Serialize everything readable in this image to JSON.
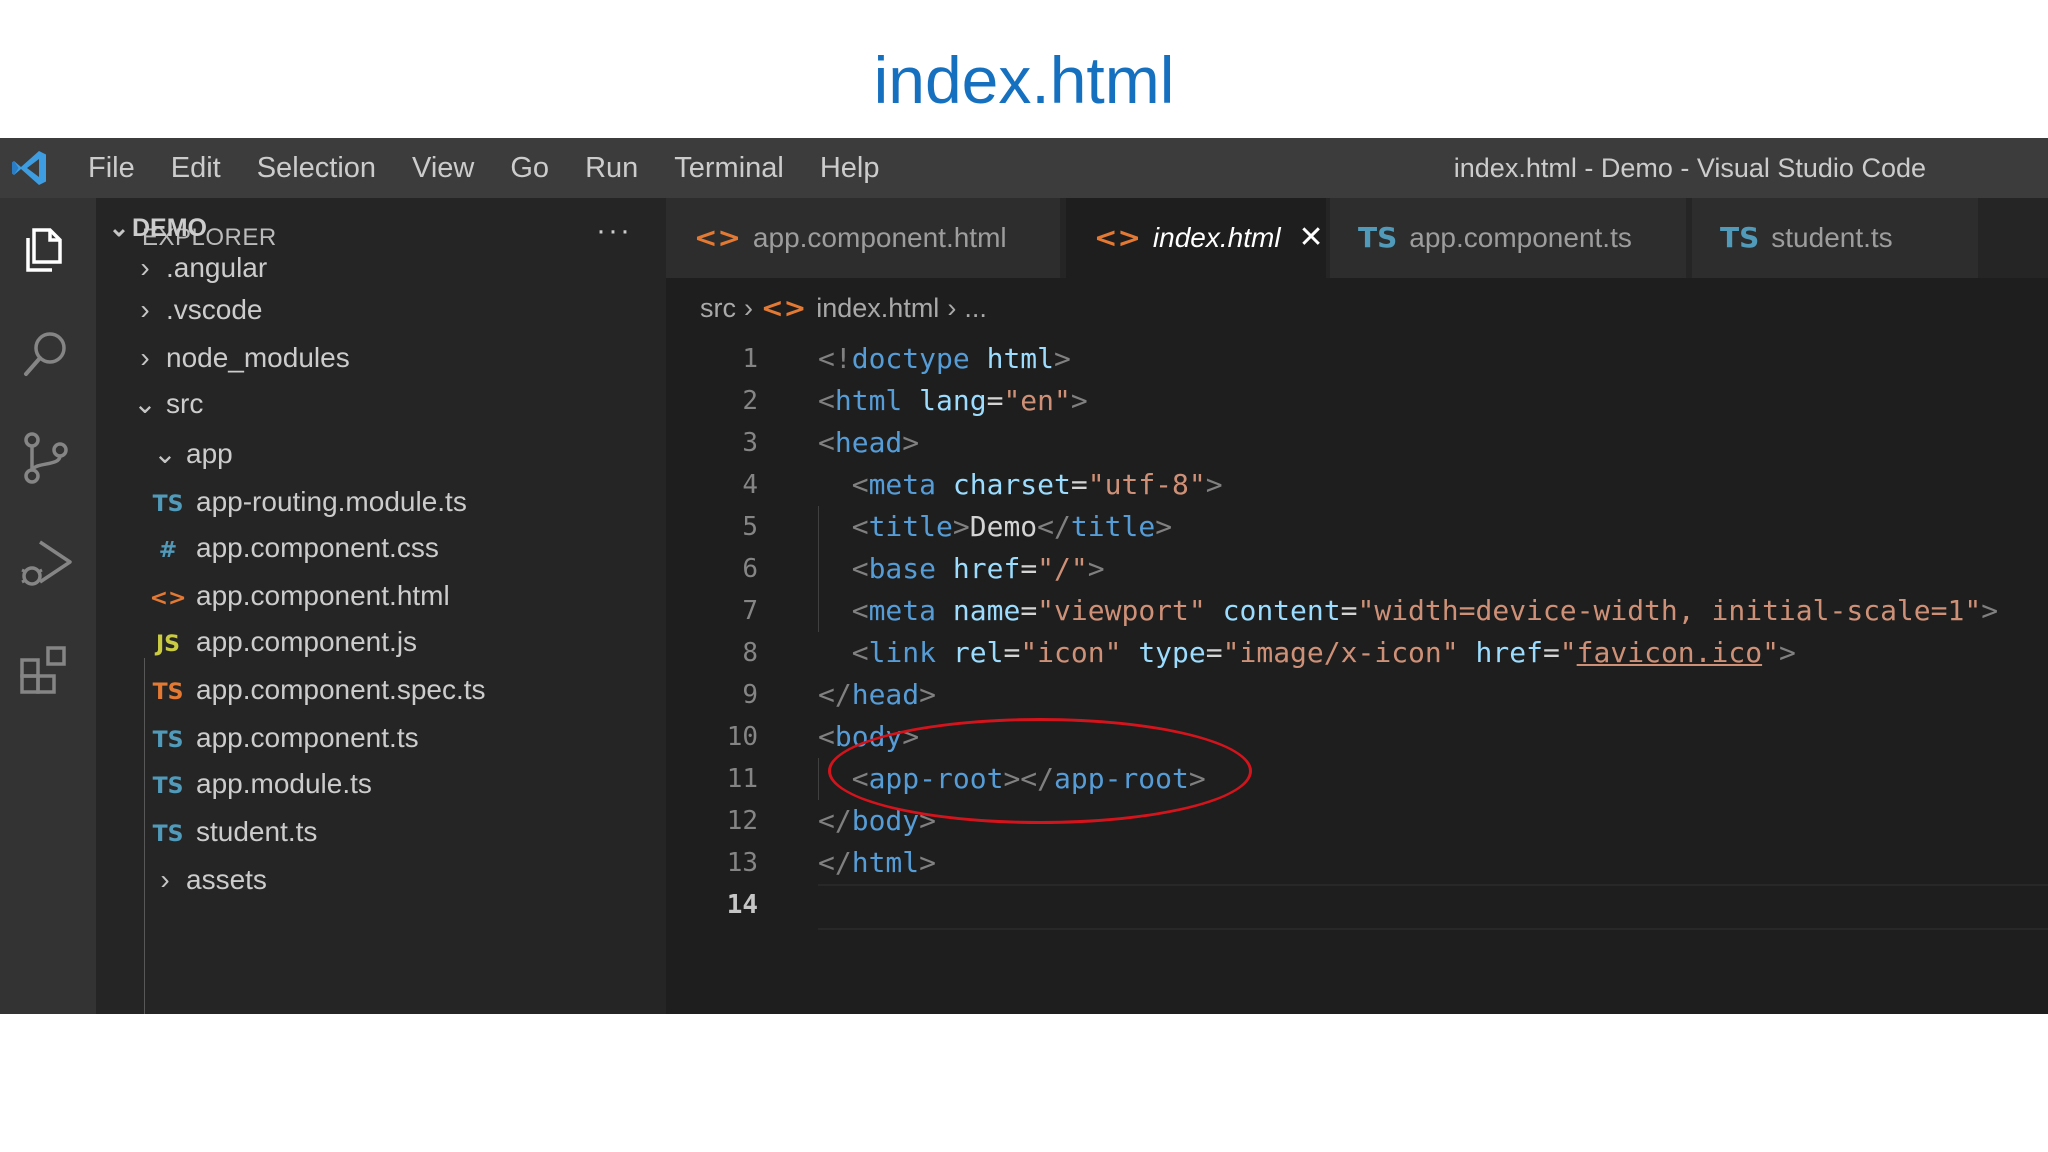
{
  "slide": {
    "title": "index.html"
  },
  "titlebar": {
    "menu": [
      "File",
      "Edit",
      "Selection",
      "View",
      "Go",
      "Run",
      "Terminal",
      "Help"
    ],
    "window_title": "index.html - Demo - Visual Studio Code"
  },
  "activity_bar": {
    "icons": [
      "explorer-icon",
      "search-icon",
      "source-control-icon",
      "run-debug-icon",
      "extensions-icon"
    ]
  },
  "explorer": {
    "header": "EXPLORER",
    "more": "···",
    "root": "DEMO",
    "items": [
      {
        "label": ".angular",
        "type": "folder",
        "expanded": false
      },
      {
        "label": ".vscode",
        "type": "folder",
        "expanded": false
      },
      {
        "label": "node_modules",
        "type": "folder",
        "expanded": false
      },
      {
        "label": "src",
        "type": "folder",
        "expanded": true
      },
      {
        "label": "app",
        "type": "folder",
        "expanded": true
      },
      {
        "label": "app-routing.module.ts",
        "icon": "TS",
        "icon_color": "#519aba"
      },
      {
        "label": "app.component.css",
        "icon": "#",
        "icon_color": "#519aba"
      },
      {
        "label": "app.component.html",
        "icon": "<>",
        "icon_color": "#e37933"
      },
      {
        "label": "app.component.js",
        "icon": "JS",
        "icon_color": "#cbcb41"
      },
      {
        "label": "app.component.spec.ts",
        "icon": "TS",
        "icon_color": "#e37933"
      },
      {
        "label": "app.component.ts",
        "icon": "TS",
        "icon_color": "#519aba"
      },
      {
        "label": "app.module.ts",
        "icon": "TS",
        "icon_color": "#519aba"
      },
      {
        "label": "student.ts",
        "icon": "TS",
        "icon_color": "#519aba"
      },
      {
        "label": "assets",
        "type": "folder",
        "expanded": false
      }
    ]
  },
  "tabs": [
    {
      "label": "app.component.html",
      "icon": "<>",
      "icon_color": "#e37933",
      "active": false
    },
    {
      "label": "index.html",
      "icon": "<>",
      "icon_color": "#e37933",
      "active": true,
      "close": "✕"
    },
    {
      "label": "app.component.ts",
      "icon": "TS",
      "icon_color": "#519aba",
      "active": false
    },
    {
      "label": "student.ts",
      "icon": "TS",
      "icon_color": "#519aba",
      "active": false
    }
  ],
  "breadcrumb": {
    "folder": "src",
    "file": "index.html",
    "icon": "<>",
    "rest": "..."
  },
  "editor": {
    "current_line": 14,
    "lines": [
      {
        "n": "1",
        "tokens": [
          [
            "pn",
            "<!"
          ],
          [
            "tg",
            "doctype"
          ],
          [
            "tx",
            " "
          ],
          [
            "at",
            "html"
          ],
          [
            "pn",
            ">"
          ]
        ]
      },
      {
        "n": "2",
        "tokens": [
          [
            "pn",
            "<"
          ],
          [
            "tg",
            "html"
          ],
          [
            "tx",
            " "
          ],
          [
            "at",
            "lang"
          ],
          [
            "eq",
            "="
          ],
          [
            "st",
            "\"en\""
          ],
          [
            "pn",
            ">"
          ]
        ]
      },
      {
        "n": "3",
        "tokens": [
          [
            "pn",
            "<"
          ],
          [
            "tg",
            "head"
          ],
          [
            "pn",
            ">"
          ]
        ]
      },
      {
        "n": "4",
        "tokens": [
          [
            "tx",
            "  "
          ],
          [
            "pn",
            "<"
          ],
          [
            "tg",
            "meta"
          ],
          [
            "tx",
            " "
          ],
          [
            "at",
            "charset"
          ],
          [
            "eq",
            "="
          ],
          [
            "st",
            "\"utf-8\""
          ],
          [
            "pn",
            ">"
          ]
        ]
      },
      {
        "n": "5",
        "tokens": [
          [
            "tx",
            "  "
          ],
          [
            "pn",
            "<"
          ],
          [
            "tg",
            "title"
          ],
          [
            "pn",
            ">"
          ],
          [
            "tx",
            "Demo"
          ],
          [
            "pn",
            "</"
          ],
          [
            "tg",
            "title"
          ],
          [
            "pn",
            ">"
          ]
        ]
      },
      {
        "n": "6",
        "tokens": [
          [
            "tx",
            "  "
          ],
          [
            "pn",
            "<"
          ],
          [
            "tg",
            "base"
          ],
          [
            "tx",
            " "
          ],
          [
            "at",
            "href"
          ],
          [
            "eq",
            "="
          ],
          [
            "st",
            "\"/\""
          ],
          [
            "pn",
            ">"
          ]
        ]
      },
      {
        "n": "7",
        "tokens": [
          [
            "tx",
            "  "
          ],
          [
            "pn",
            "<"
          ],
          [
            "tg",
            "meta"
          ],
          [
            "tx",
            " "
          ],
          [
            "at",
            "name"
          ],
          [
            "eq",
            "="
          ],
          [
            "st",
            "\"viewport\""
          ],
          [
            "tx",
            " "
          ],
          [
            "at",
            "content"
          ],
          [
            "eq",
            "="
          ],
          [
            "st",
            "\"width=device-width, initial-scale=1\""
          ],
          [
            "pn",
            ">"
          ]
        ]
      },
      {
        "n": "8",
        "tokens": [
          [
            "tx",
            "  "
          ],
          [
            "pn",
            "<"
          ],
          [
            "tg",
            "link"
          ],
          [
            "tx",
            " "
          ],
          [
            "at",
            "rel"
          ],
          [
            "eq",
            "="
          ],
          [
            "st",
            "\"icon\""
          ],
          [
            "tx",
            " "
          ],
          [
            "at",
            "type"
          ],
          [
            "eq",
            "="
          ],
          [
            "st",
            "\"image/x-icon\""
          ],
          [
            "tx",
            " "
          ],
          [
            "at",
            "href"
          ],
          [
            "eq",
            "="
          ],
          [
            "st",
            "\""
          ],
          [
            "stu",
            "favicon.ico"
          ],
          [
            "st",
            "\""
          ],
          [
            "pn",
            ">"
          ]
        ]
      },
      {
        "n": "9",
        "tokens": [
          [
            "pn",
            "</"
          ],
          [
            "tg",
            "head"
          ],
          [
            "pn",
            ">"
          ]
        ]
      },
      {
        "n": "10",
        "tokens": [
          [
            "pn",
            "<"
          ],
          [
            "tg",
            "body"
          ],
          [
            "pn",
            ">"
          ]
        ]
      },
      {
        "n": "11",
        "tokens": [
          [
            "tx",
            "  "
          ],
          [
            "pn",
            "<"
          ],
          [
            "tg",
            "app-root"
          ],
          [
            "pn",
            "></"
          ],
          [
            "tg",
            "app-root"
          ],
          [
            "pn",
            ">"
          ]
        ]
      },
      {
        "n": "12",
        "tokens": [
          [
            "pn",
            "</"
          ],
          [
            "tg",
            "body"
          ],
          [
            "pn",
            ">"
          ]
        ]
      },
      {
        "n": "13",
        "tokens": [
          [
            "pn",
            "</"
          ],
          [
            "tg",
            "html"
          ],
          [
            "pn",
            ">"
          ]
        ]
      },
      {
        "n": "14",
        "tokens": []
      }
    ]
  },
  "colors": {
    "annotation": "#d4141c",
    "title": "#1670c0"
  }
}
